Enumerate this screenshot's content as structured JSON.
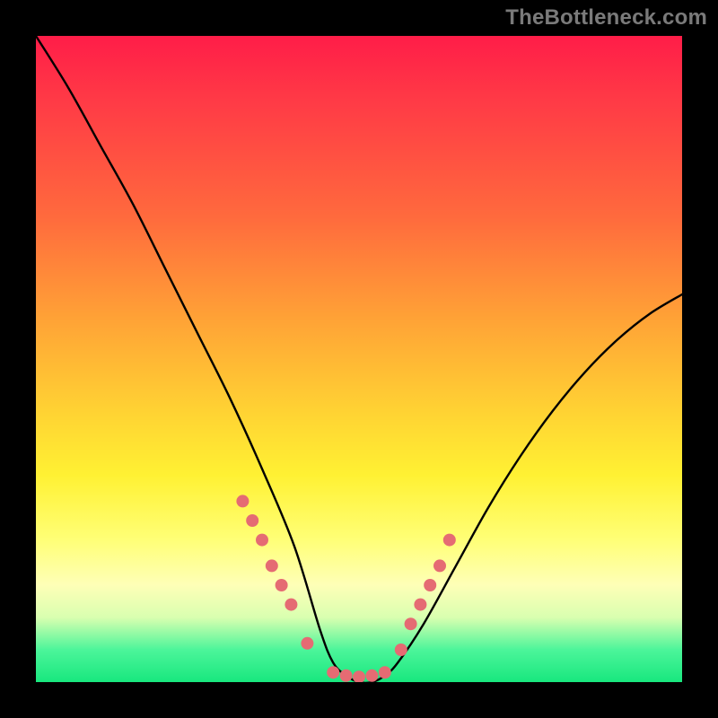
{
  "watermark": "TheBottleneck.com",
  "chart_data": {
    "type": "line",
    "title": "",
    "xlabel": "",
    "ylabel": "",
    "xlim": [
      0,
      100
    ],
    "ylim": [
      0,
      100
    ],
    "series": [
      {
        "name": "bottleneck-curve",
        "x": [
          0,
          5,
          10,
          15,
          20,
          25,
          30,
          35,
          40,
          44,
          46,
          48,
          50,
          52,
          54,
          56,
          60,
          65,
          70,
          75,
          80,
          85,
          90,
          95,
          100
        ],
        "y": [
          100,
          92,
          83,
          74,
          64,
          54,
          44,
          33,
          21,
          8,
          3,
          1,
          0,
          0,
          1,
          3,
          9,
          18,
          27,
          35,
          42,
          48,
          53,
          57,
          60
        ]
      }
    ],
    "markers": {
      "name": "highlight-dots",
      "color": "#e56b73",
      "x": [
        32,
        33.5,
        35,
        36.5,
        38,
        39.5,
        42,
        46,
        48,
        50,
        52,
        54,
        56.5,
        58,
        59.5,
        61,
        62.5,
        64
      ],
      "y": [
        28,
        25,
        22,
        18,
        15,
        12,
        6,
        1.5,
        1,
        0.8,
        1,
        1.5,
        5,
        9,
        12,
        15,
        18,
        22
      ]
    }
  }
}
